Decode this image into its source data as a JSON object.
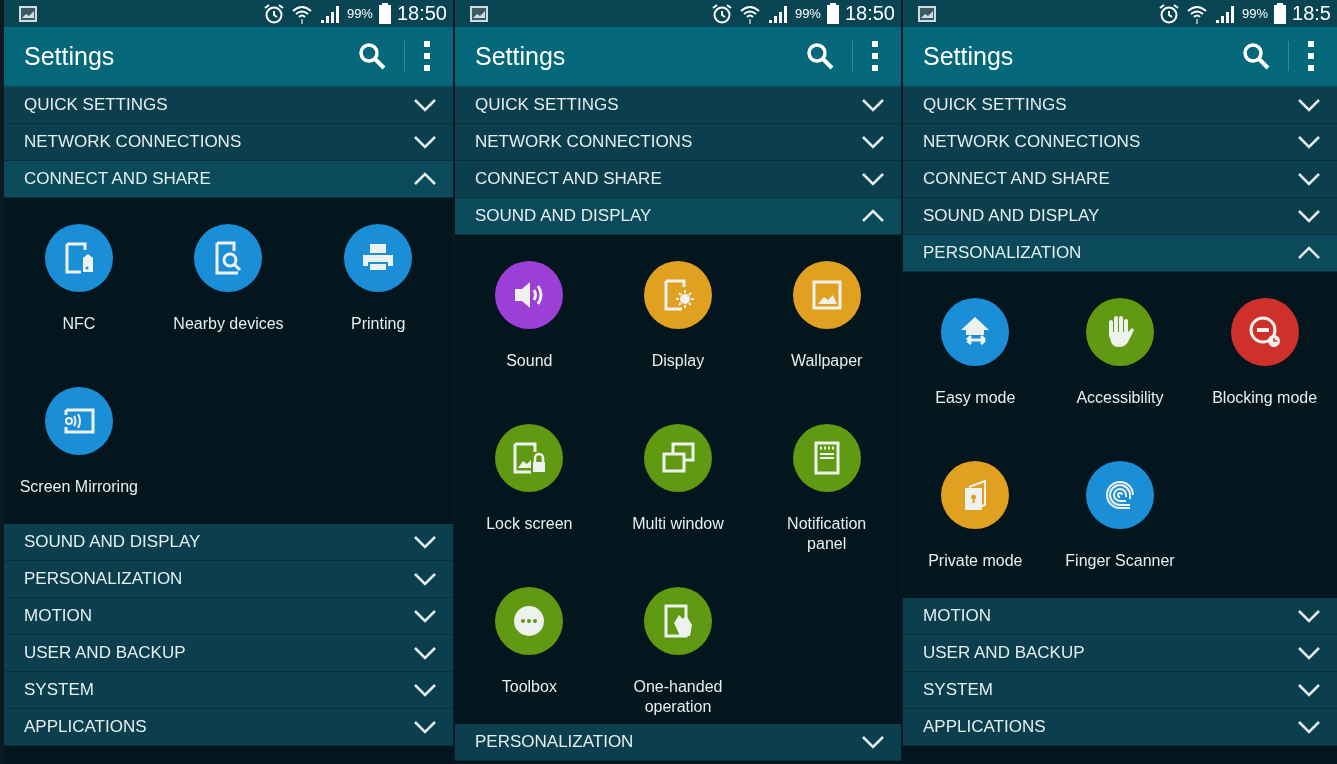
{
  "screens": [
    {
      "status": {
        "battery": "99%",
        "time": "18:50"
      },
      "title": "Settings",
      "sections": [
        {
          "label": "QUICK SETTINGS",
          "expanded": false
        },
        {
          "label": "NETWORK CONNECTIONS",
          "expanded": false
        },
        {
          "label": "CONNECT AND SHARE",
          "expanded": true,
          "items": [
            {
              "label": "NFC",
              "kind": "nfc",
              "color": "#1a8fd8"
            },
            {
              "label": "Nearby devices",
              "kind": "nearby",
              "color": "#1a8fd8"
            },
            {
              "label": "Printing",
              "kind": "printer",
              "color": "#1a8fd8"
            },
            {
              "label": "Screen Mirroring",
              "kind": "mirroring",
              "color": "#1a8fd8"
            }
          ]
        },
        {
          "label": "SOUND AND DISPLAY",
          "expanded": false
        },
        {
          "label": "PERSONALIZATION",
          "expanded": false
        },
        {
          "label": "MOTION",
          "expanded": false
        },
        {
          "label": "USER AND BACKUP",
          "expanded": false
        },
        {
          "label": "SYSTEM",
          "expanded": false
        },
        {
          "label": "APPLICATIONS",
          "expanded": false
        }
      ]
    },
    {
      "status": {
        "battery": "99%",
        "time": "18:50"
      },
      "title": "Settings",
      "sections": [
        {
          "label": "QUICK SETTINGS",
          "expanded": false
        },
        {
          "label": "NETWORK CONNECTIONS",
          "expanded": false
        },
        {
          "label": "CONNECT AND SHARE",
          "expanded": false
        },
        {
          "label": "SOUND AND DISPLAY",
          "expanded": true,
          "items": [
            {
              "label": "Sound",
              "kind": "speaker",
              "color": "#9b3fd6"
            },
            {
              "label": "Display",
              "kind": "display",
              "color": "#e0a020"
            },
            {
              "label": "Wallpaper",
              "kind": "wallpaper",
              "color": "#e0a020"
            },
            {
              "label": "Lock screen",
              "kind": "lock",
              "color": "#5f9a12"
            },
            {
              "label": "Multi window",
              "kind": "windows",
              "color": "#5f9a12"
            },
            {
              "label": "Notification panel",
              "kind": "panel",
              "color": "#5f9a12"
            },
            {
              "label": "Toolbox",
              "kind": "toolbox",
              "color": "#5f9a12"
            },
            {
              "label": "One-handed operation",
              "kind": "hand-screen",
              "color": "#5f9a12"
            }
          ]
        },
        {
          "label": "PERSONALIZATION",
          "expanded": false
        }
      ]
    },
    {
      "status": {
        "battery": "99%",
        "time": "18:5"
      },
      "title": "Settings",
      "sections": [
        {
          "label": "QUICK SETTINGS",
          "expanded": false
        },
        {
          "label": "NETWORK CONNECTIONS",
          "expanded": false
        },
        {
          "label": "CONNECT AND SHARE",
          "expanded": false
        },
        {
          "label": "SOUND AND DISPLAY",
          "expanded": false
        },
        {
          "label": "PERSONALIZATION",
          "expanded": true,
          "items": [
            {
              "label": "Easy mode",
              "kind": "house",
              "color": "#1a8fd8"
            },
            {
              "label": "Accessibility",
              "kind": "hand",
              "color": "#5f9a12"
            },
            {
              "label": "Blocking mode",
              "kind": "blocking",
              "color": "#d0302c"
            },
            {
              "label": "Private mode",
              "kind": "private",
              "color": "#e0a020"
            },
            {
              "label": "Finger Scanner",
              "kind": "fingerprint",
              "color": "#1a8fd8"
            }
          ]
        },
        {
          "label": "MOTION",
          "expanded": false
        },
        {
          "label": "USER AND BACKUP",
          "expanded": false
        },
        {
          "label": "SYSTEM",
          "expanded": false
        },
        {
          "label": "APPLICATIONS",
          "expanded": false
        }
      ]
    }
  ]
}
